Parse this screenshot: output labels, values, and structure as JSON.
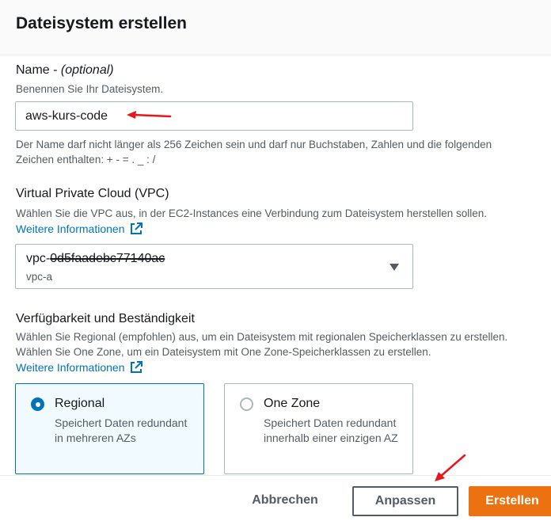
{
  "dialog": {
    "title": "Dateisystem erstellen"
  },
  "name_field": {
    "label": "Name - ",
    "label_optional": "(optional)",
    "description": "Benennen Sie Ihr Dateisystem.",
    "value": "aws-kurs-code",
    "constraint": "Der Name darf nicht länger als 256 Zeichen sein und darf nur Buchstaben, Zahlen und die folgenden Zeichen enthalten: + - = . _ : /"
  },
  "vpc_field": {
    "label": "Virtual Private Cloud (VPC)",
    "description": "Wählen Sie die VPC aus, in der EC2-Instances eine Verbindung zum Dateisystem herstellen sollen.",
    "info_link": "Weitere Informationen",
    "selected_prefix": "vpc-",
    "selected_redacted": "0d5faadebc77140ac",
    "selected_sub": "vpc-a"
  },
  "availability": {
    "label": "Verfügbarkeit und Beständigkeit",
    "description": "Wählen Sie Regional (empfohlen) aus, um ein Dateisystem mit regionalen Speicherklassen zu erstellen. Wählen Sie One Zone, um ein Dateisystem mit One Zone-Speicherklassen zu erstellen.",
    "info_link": "Weitere Informationen",
    "options": [
      {
        "title": "Regional",
        "description": "Speichert Daten redundant in mehreren AZs",
        "selected": true
      },
      {
        "title": "One Zone",
        "description": "Speichert Daten redundant innerhalb einer einzigen AZ",
        "selected": false
      }
    ]
  },
  "footer": {
    "cancel_label": "Abbrechen",
    "customize_label": "Anpassen",
    "create_label": "Erstellen"
  },
  "colors": {
    "link": "#0073bb",
    "primary_button": "#ec7211",
    "annotation_arrow": "#e8161b"
  }
}
